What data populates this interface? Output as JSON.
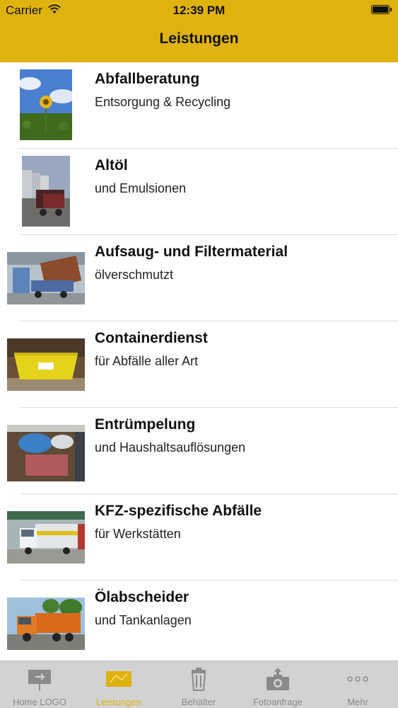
{
  "status_bar": {
    "carrier": "Carrier",
    "time": "12:39 PM"
  },
  "nav": {
    "title": "Leistungen"
  },
  "services": [
    {
      "title": "Abfallberatung",
      "subtitle": "Entsorgung & Recycling",
      "image": "sunflower-photo"
    },
    {
      "title": "Altöl",
      "subtitle": "und Emulsionen",
      "image": "tank-truck-photo"
    },
    {
      "title": "Aufsaug- und Filtermaterial",
      "subtitle": "ölverschmutzt",
      "image": "warehouse-truck-photo"
    },
    {
      "title": "Containerdienst",
      "subtitle": "für Abfälle aller Art",
      "image": "yellow-container-photo"
    },
    {
      "title": "Entrümpelung",
      "subtitle": "und Haushaltsauflösungen",
      "image": "clearance-container-photo"
    },
    {
      "title": "KFZ-spezifische Abfälle",
      "subtitle": "für Werkstätten",
      "image": "delivery-truck-photo"
    },
    {
      "title": "Ölabscheider",
      "subtitle": "und Tankanlagen",
      "image": "suction-truck-photo"
    }
  ],
  "tabbar": {
    "active": "Leistungen",
    "tabs": [
      {
        "label": "Home LOGO",
        "icon": "logo-sign-icon"
      },
      {
        "label": "Leistungen",
        "icon": "truck-logo-icon"
      },
      {
        "label": "Behälter",
        "icon": "trash-bin-icon"
      },
      {
        "label": "Fotoanfrage",
        "icon": "camera-upload-icon"
      },
      {
        "label": "Mehr",
        "icon": "more-dots-icon"
      }
    ]
  },
  "colors": {
    "accent": "#dfb20e",
    "tab_inactive": "#8a8a8a",
    "tabbar_bg": "#d2d2d2"
  }
}
